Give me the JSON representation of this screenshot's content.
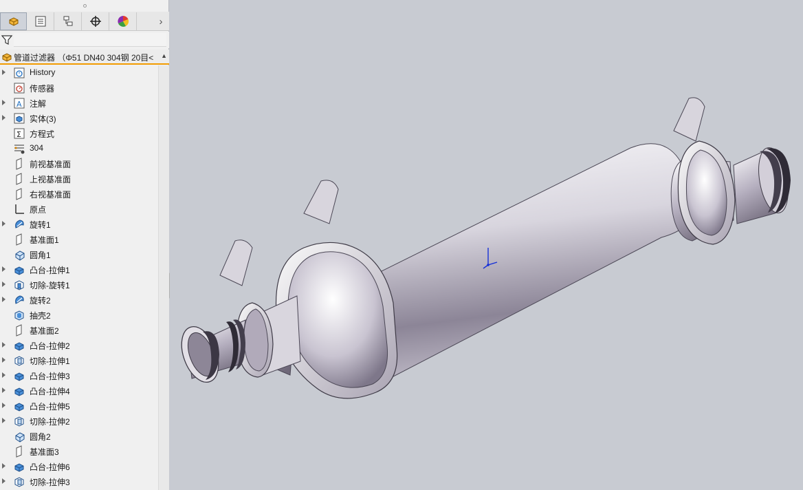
{
  "feature_manager": {
    "tabs": [
      {
        "name": "feature-manager-tab",
        "icon": "part-icon",
        "active": true
      },
      {
        "name": "property-manager-tab",
        "icon": "property-icon",
        "active": false
      },
      {
        "name": "configuration-manager-tab",
        "icon": "configuration-icon",
        "active": false
      },
      {
        "name": "dimxpert-tab",
        "icon": "crosshair-icon",
        "active": false
      },
      {
        "name": "display-manager-tab",
        "icon": "color-wheel-icon",
        "active": false
      }
    ],
    "more_tabs_glyph": "›",
    "root_label": "管道过滤器 （Φ51 DN40 304钢 20目<",
    "tree": [
      {
        "label": "History",
        "icon": "history-icon",
        "expandable": true
      },
      {
        "label": "传感器",
        "icon": "sensor-icon",
        "expandable": false
      },
      {
        "label": "注解",
        "icon": "annotation-icon",
        "expandable": true
      },
      {
        "label": "实体(3)",
        "icon": "solid-bodies-icon",
        "expandable": true
      },
      {
        "label": "方程式",
        "icon": "equations-icon",
        "expandable": false
      },
      {
        "label": "304",
        "icon": "material-icon",
        "expandable": false
      },
      {
        "label": "前视基准面",
        "icon": "plane-icon",
        "expandable": false
      },
      {
        "label": "上视基准面",
        "icon": "plane-icon",
        "expandable": false
      },
      {
        "label": "右视基准面",
        "icon": "plane-icon",
        "expandable": false
      },
      {
        "label": "原点",
        "icon": "origin-icon",
        "expandable": false
      },
      {
        "label": "旋转1",
        "icon": "revolve-icon",
        "expandable": true
      },
      {
        "label": "基准面1",
        "icon": "plane-icon",
        "expandable": false
      },
      {
        "label": "圆角1",
        "icon": "fillet-icon",
        "expandable": false
      },
      {
        "label": "凸台-拉伸1",
        "icon": "boss-extrude-icon",
        "expandable": true
      },
      {
        "label": "切除-旋转1",
        "icon": "cut-revolve-icon",
        "expandable": true
      },
      {
        "label": "旋转2",
        "icon": "revolve-icon",
        "expandable": true
      },
      {
        "label": "抽壳2",
        "icon": "shell-icon",
        "expandable": false
      },
      {
        "label": "基准面2",
        "icon": "plane-icon",
        "expandable": false
      },
      {
        "label": "凸台-拉伸2",
        "icon": "boss-extrude-icon",
        "expandable": true
      },
      {
        "label": "切除-拉伸1",
        "icon": "cut-extrude-icon",
        "expandable": true
      },
      {
        "label": "凸台-拉伸3",
        "icon": "boss-extrude-icon",
        "expandable": true
      },
      {
        "label": "凸台-拉伸4",
        "icon": "boss-extrude-icon",
        "expandable": true
      },
      {
        "label": "凸台-拉伸5",
        "icon": "boss-extrude-icon",
        "expandable": true
      },
      {
        "label": "切除-拉伸2",
        "icon": "cut-extrude-icon",
        "expandable": true
      },
      {
        "label": "圆角2",
        "icon": "fillet-icon",
        "expandable": false
      },
      {
        "label": "基准面3",
        "icon": "plane-icon",
        "expandable": false
      },
      {
        "label": "凸台-拉伸6",
        "icon": "boss-extrude-icon",
        "expandable": true
      },
      {
        "label": "切除-拉伸3",
        "icon": "cut-extrude-icon",
        "expandable": true
      }
    ]
  },
  "colors": {
    "accent_orange": "#f29b00",
    "tree_blue": "#1f6fc0",
    "triad_blue": "#1530d8",
    "viewport_bg": "#c8cbd2"
  }
}
